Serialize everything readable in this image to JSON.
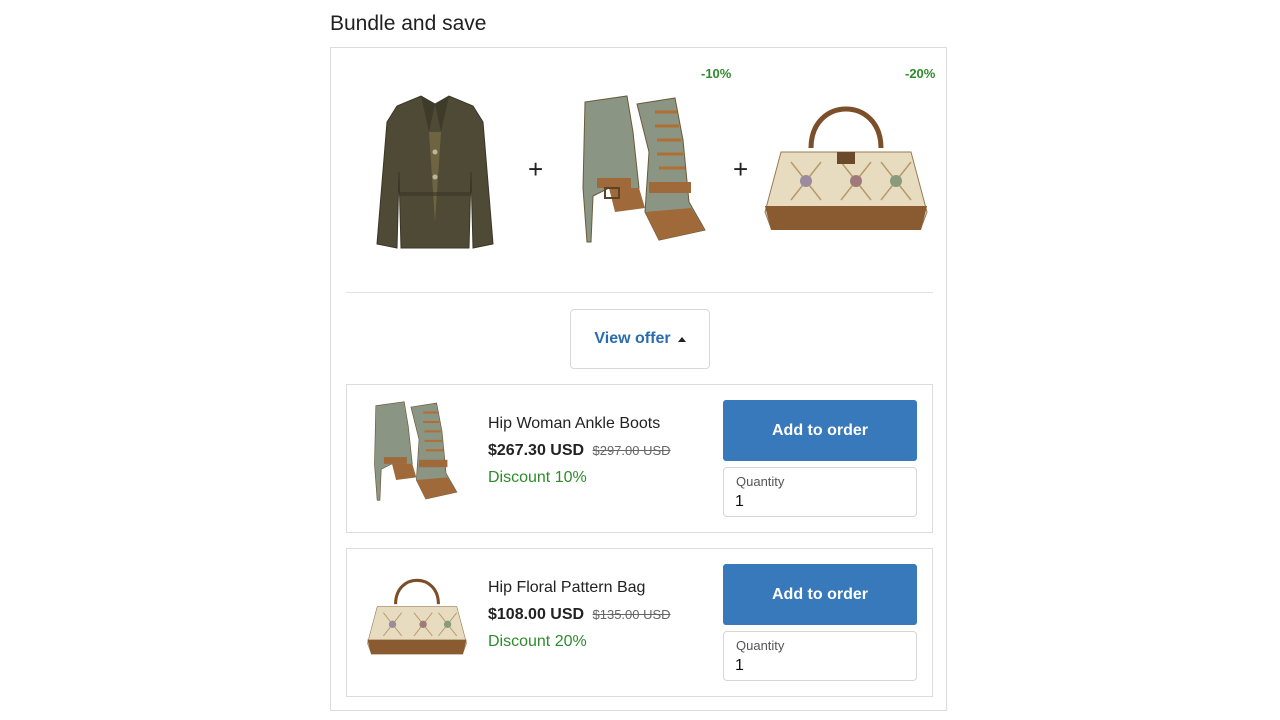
{
  "section_title": "Bundle and save",
  "hero": {
    "items": [
      {
        "icon": "jacket-image",
        "discount": ""
      },
      {
        "icon": "ankle-boots-image",
        "discount": "-10%"
      },
      {
        "icon": "floral-bag-image",
        "discount": "-20%"
      }
    ],
    "plus_symbol": "+"
  },
  "view_offer_label": "View offer",
  "offers": [
    {
      "name": "Hip Woman Ankle Boots",
      "price": "$267.30 USD",
      "old_price": "$297.00 USD",
      "discount": "Discount 10%",
      "button_label": "Add to order",
      "quantity_label": "Quantity",
      "quantity_value": "1"
    },
    {
      "name": "Hip Floral Pattern Bag",
      "price": "$108.00 USD",
      "old_price": "$135.00 USD",
      "discount": "Discount 20%",
      "button_label": "Add to order",
      "quantity_label": "Quantity",
      "quantity_value": "1"
    }
  ],
  "colors": {
    "accent_blue": "#3879bb",
    "link_blue": "#2b6cb0",
    "discount_green": "#2e8b2e"
  }
}
